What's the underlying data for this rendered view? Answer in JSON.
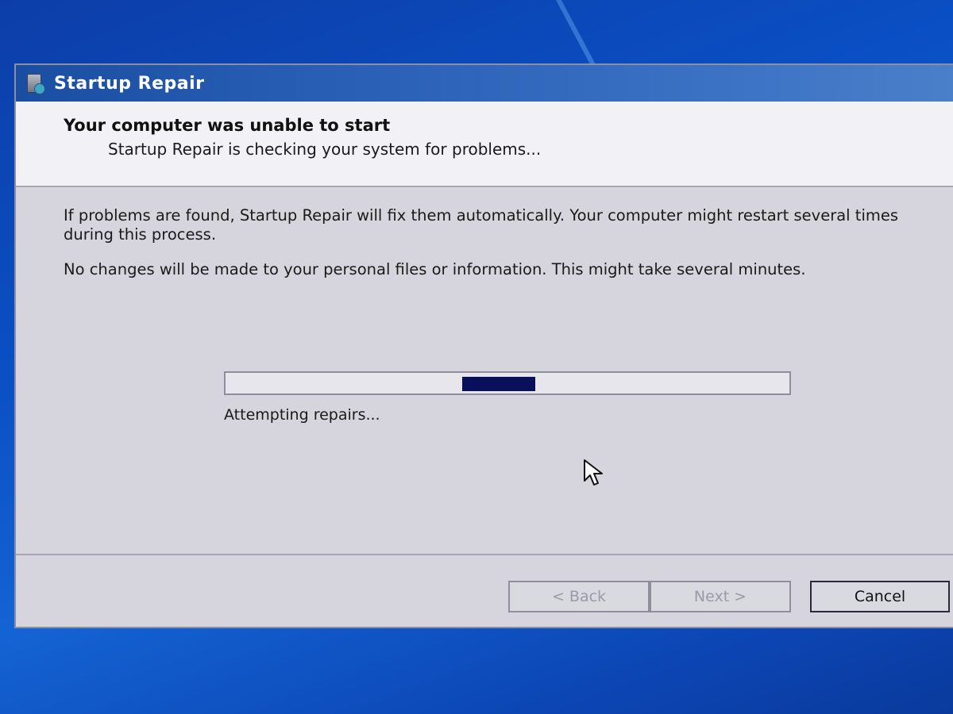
{
  "window": {
    "title": "Startup Repair"
  },
  "header": {
    "title": "Your computer was unable to start",
    "subtitle": "Startup Repair is checking your system for problems..."
  },
  "content": {
    "paragraph1": "If problems are found, Startup Repair will fix them automatically. Your computer might restart several times during this process.",
    "paragraph2": "No changes will be made to your personal files or information. This might take several minutes.",
    "progress": {
      "status": "Attempting repairs...",
      "indeterminate": true,
      "segment_start_fraction": 0.42,
      "segment_length_fraction": 0.13,
      "fill_color": "#08105c"
    }
  },
  "buttons": {
    "back": "< Back",
    "next": "Next >",
    "cancel": "Cancel"
  },
  "icons": {
    "title_icon": "startup-repair-icon",
    "pointer": "mouse-pointer-icon"
  }
}
